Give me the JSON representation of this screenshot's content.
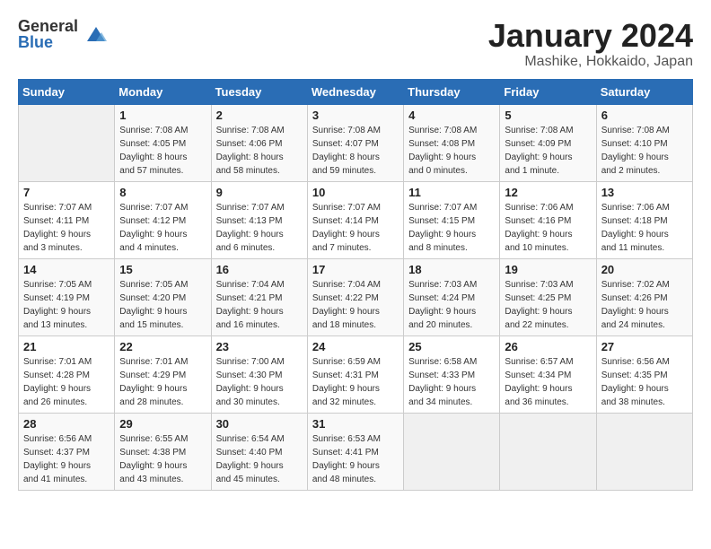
{
  "header": {
    "logo_general": "General",
    "logo_blue": "Blue",
    "title": "January 2024",
    "subtitle": "Mashike, Hokkaido, Japan"
  },
  "days_of_week": [
    "Sunday",
    "Monday",
    "Tuesday",
    "Wednesday",
    "Thursday",
    "Friday",
    "Saturday"
  ],
  "weeks": [
    [
      {
        "day": "",
        "sunrise": "",
        "sunset": "",
        "daylight": "",
        "empty": true
      },
      {
        "day": "1",
        "sunrise": "Sunrise: 7:08 AM",
        "sunset": "Sunset: 4:05 PM",
        "daylight": "Daylight: 8 hours and 57 minutes."
      },
      {
        "day": "2",
        "sunrise": "Sunrise: 7:08 AM",
        "sunset": "Sunset: 4:06 PM",
        "daylight": "Daylight: 8 hours and 58 minutes."
      },
      {
        "day": "3",
        "sunrise": "Sunrise: 7:08 AM",
        "sunset": "Sunset: 4:07 PM",
        "daylight": "Daylight: 8 hours and 59 minutes."
      },
      {
        "day": "4",
        "sunrise": "Sunrise: 7:08 AM",
        "sunset": "Sunset: 4:08 PM",
        "daylight": "Daylight: 9 hours and 0 minutes."
      },
      {
        "day": "5",
        "sunrise": "Sunrise: 7:08 AM",
        "sunset": "Sunset: 4:09 PM",
        "daylight": "Daylight: 9 hours and 1 minute."
      },
      {
        "day": "6",
        "sunrise": "Sunrise: 7:08 AM",
        "sunset": "Sunset: 4:10 PM",
        "daylight": "Daylight: 9 hours and 2 minutes."
      }
    ],
    [
      {
        "day": "7",
        "sunrise": "Sunrise: 7:07 AM",
        "sunset": "Sunset: 4:11 PM",
        "daylight": "Daylight: 9 hours and 3 minutes."
      },
      {
        "day": "8",
        "sunrise": "Sunrise: 7:07 AM",
        "sunset": "Sunset: 4:12 PM",
        "daylight": "Daylight: 9 hours and 4 minutes."
      },
      {
        "day": "9",
        "sunrise": "Sunrise: 7:07 AM",
        "sunset": "Sunset: 4:13 PM",
        "daylight": "Daylight: 9 hours and 6 minutes."
      },
      {
        "day": "10",
        "sunrise": "Sunrise: 7:07 AM",
        "sunset": "Sunset: 4:14 PM",
        "daylight": "Daylight: 9 hours and 7 minutes."
      },
      {
        "day": "11",
        "sunrise": "Sunrise: 7:07 AM",
        "sunset": "Sunset: 4:15 PM",
        "daylight": "Daylight: 9 hours and 8 minutes."
      },
      {
        "day": "12",
        "sunrise": "Sunrise: 7:06 AM",
        "sunset": "Sunset: 4:16 PM",
        "daylight": "Daylight: 9 hours and 10 minutes."
      },
      {
        "day": "13",
        "sunrise": "Sunrise: 7:06 AM",
        "sunset": "Sunset: 4:18 PM",
        "daylight": "Daylight: 9 hours and 11 minutes."
      }
    ],
    [
      {
        "day": "14",
        "sunrise": "Sunrise: 7:05 AM",
        "sunset": "Sunset: 4:19 PM",
        "daylight": "Daylight: 9 hours and 13 minutes."
      },
      {
        "day": "15",
        "sunrise": "Sunrise: 7:05 AM",
        "sunset": "Sunset: 4:20 PM",
        "daylight": "Daylight: 9 hours and 15 minutes."
      },
      {
        "day": "16",
        "sunrise": "Sunrise: 7:04 AM",
        "sunset": "Sunset: 4:21 PM",
        "daylight": "Daylight: 9 hours and 16 minutes."
      },
      {
        "day": "17",
        "sunrise": "Sunrise: 7:04 AM",
        "sunset": "Sunset: 4:22 PM",
        "daylight": "Daylight: 9 hours and 18 minutes."
      },
      {
        "day": "18",
        "sunrise": "Sunrise: 7:03 AM",
        "sunset": "Sunset: 4:24 PM",
        "daylight": "Daylight: 9 hours and 20 minutes."
      },
      {
        "day": "19",
        "sunrise": "Sunrise: 7:03 AM",
        "sunset": "Sunset: 4:25 PM",
        "daylight": "Daylight: 9 hours and 22 minutes."
      },
      {
        "day": "20",
        "sunrise": "Sunrise: 7:02 AM",
        "sunset": "Sunset: 4:26 PM",
        "daylight": "Daylight: 9 hours and 24 minutes."
      }
    ],
    [
      {
        "day": "21",
        "sunrise": "Sunrise: 7:01 AM",
        "sunset": "Sunset: 4:28 PM",
        "daylight": "Daylight: 9 hours and 26 minutes."
      },
      {
        "day": "22",
        "sunrise": "Sunrise: 7:01 AM",
        "sunset": "Sunset: 4:29 PM",
        "daylight": "Daylight: 9 hours and 28 minutes."
      },
      {
        "day": "23",
        "sunrise": "Sunrise: 7:00 AM",
        "sunset": "Sunset: 4:30 PM",
        "daylight": "Daylight: 9 hours and 30 minutes."
      },
      {
        "day": "24",
        "sunrise": "Sunrise: 6:59 AM",
        "sunset": "Sunset: 4:31 PM",
        "daylight": "Daylight: 9 hours and 32 minutes."
      },
      {
        "day": "25",
        "sunrise": "Sunrise: 6:58 AM",
        "sunset": "Sunset: 4:33 PM",
        "daylight": "Daylight: 9 hours and 34 minutes."
      },
      {
        "day": "26",
        "sunrise": "Sunrise: 6:57 AM",
        "sunset": "Sunset: 4:34 PM",
        "daylight": "Daylight: 9 hours and 36 minutes."
      },
      {
        "day": "27",
        "sunrise": "Sunrise: 6:56 AM",
        "sunset": "Sunset: 4:35 PM",
        "daylight": "Daylight: 9 hours and 38 minutes."
      }
    ],
    [
      {
        "day": "28",
        "sunrise": "Sunrise: 6:56 AM",
        "sunset": "Sunset: 4:37 PM",
        "daylight": "Daylight: 9 hours and 41 minutes."
      },
      {
        "day": "29",
        "sunrise": "Sunrise: 6:55 AM",
        "sunset": "Sunset: 4:38 PM",
        "daylight": "Daylight: 9 hours and 43 minutes."
      },
      {
        "day": "30",
        "sunrise": "Sunrise: 6:54 AM",
        "sunset": "Sunset: 4:40 PM",
        "daylight": "Daylight: 9 hours and 45 minutes."
      },
      {
        "day": "31",
        "sunrise": "Sunrise: 6:53 AM",
        "sunset": "Sunset: 4:41 PM",
        "daylight": "Daylight: 9 hours and 48 minutes."
      },
      {
        "day": "",
        "sunrise": "",
        "sunset": "",
        "daylight": "",
        "empty": true
      },
      {
        "day": "",
        "sunrise": "",
        "sunset": "",
        "daylight": "",
        "empty": true
      },
      {
        "day": "",
        "sunrise": "",
        "sunset": "",
        "daylight": "",
        "empty": true
      }
    ]
  ]
}
